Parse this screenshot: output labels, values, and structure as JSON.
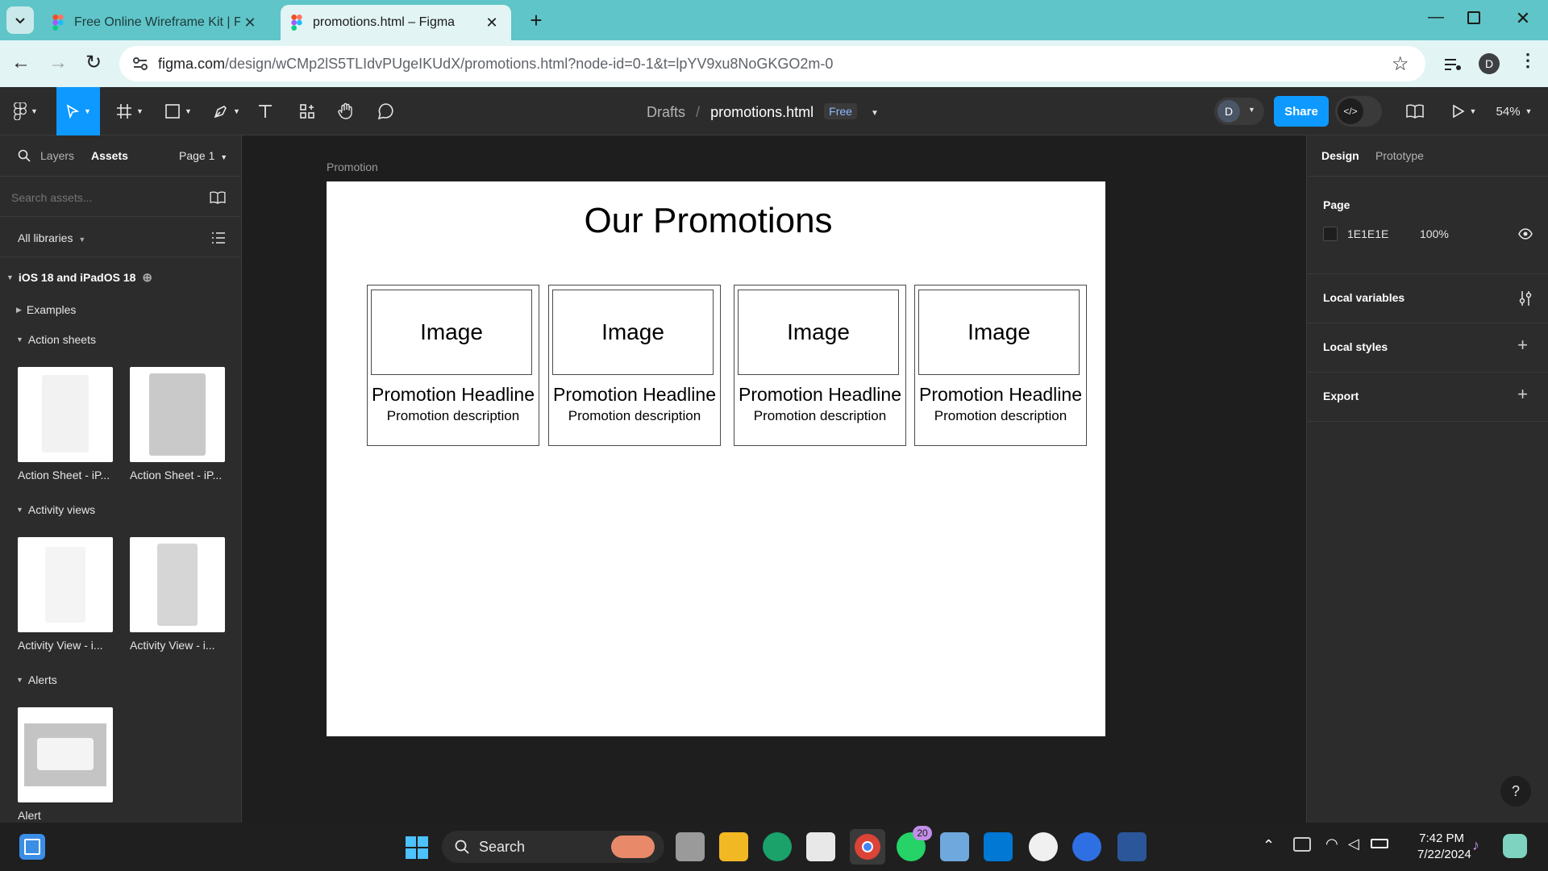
{
  "browser": {
    "tabs": [
      {
        "title": "Free Online Wireframe Kit | Figm",
        "active": false
      },
      {
        "title": "promotions.html – Figma",
        "active": true
      }
    ],
    "new_tab_label": "+",
    "url_host": "figma.com",
    "url_path": "/design/wCMp2lS5TLIdvPUgeIKUdX/promotions.html?node-id=0-1&t=lpYV9xu8NoGKGO2m-0",
    "profile_initial": "D"
  },
  "figma_toolbar": {
    "breadcrumb_parent": "Drafts",
    "breadcrumb_sep": "/",
    "file_name": "promotions.html",
    "plan_badge": "Free",
    "avatar_initial": "D",
    "share_label": "Share",
    "zoom_label": "54%"
  },
  "left_panel": {
    "tab_layers": "Layers",
    "tab_assets": "Assets",
    "page_selector": "Page 1",
    "search_placeholder": "Search assets...",
    "libraries_label": "All libraries",
    "library_name": "iOS 18 and iPadOS 18",
    "sections": [
      {
        "title": "Examples",
        "expanded": false
      },
      {
        "title": "Action sheets",
        "expanded": true,
        "items": [
          "Action Sheet - iP...",
          "Action Sheet - iP..."
        ]
      },
      {
        "title": "Activity views",
        "expanded": true,
        "items": [
          "Activity View - i...",
          "Activity View - i..."
        ]
      },
      {
        "title": "Alerts",
        "expanded": true,
        "items": [
          "Alert"
        ]
      }
    ]
  },
  "canvas": {
    "frame_label": "Promotion",
    "title": "Our Promotions",
    "cards": [
      {
        "image": "Image",
        "headline": "Promotion Headline",
        "description": "Promotion description"
      },
      {
        "image": "Image",
        "headline": "Promotion Headline",
        "description": "Promotion description"
      },
      {
        "image": "Image",
        "headline": "Promotion Headline",
        "description": "Promotion description"
      },
      {
        "image": "Image",
        "headline": "Promotion Headline",
        "description": "Promotion description"
      }
    ]
  },
  "right_panel": {
    "tab_design": "Design",
    "tab_prototype": "Prototype",
    "page_heading": "Page",
    "page_color": "1E1E1E",
    "page_opacity": "100%",
    "local_variables": "Local variables",
    "local_styles": "Local styles",
    "export": "Export",
    "help": "?"
  },
  "taskbar": {
    "search_label": "Search",
    "whatsapp_badge": "20",
    "time": "7:42 PM",
    "date": "7/22/2024"
  },
  "colors": {
    "tab_strip": "#5fc5c8",
    "figma_accent": "#0d99ff",
    "panel_bg": "#2c2c2c",
    "canvas_bg": "#1e1e1e"
  }
}
